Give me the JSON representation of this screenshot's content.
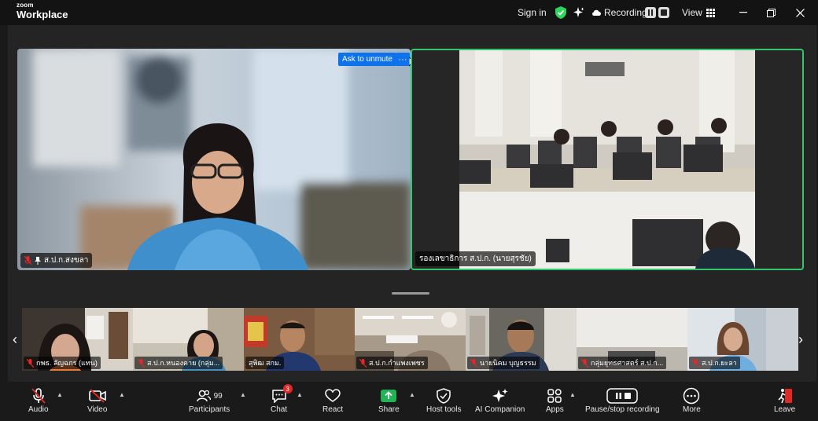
{
  "titlebar": {
    "brand_small": "zoom",
    "brand_big": "Workplace",
    "sign_in": "Sign in",
    "recording": "Recording...",
    "view": "View"
  },
  "stage": {
    "ask_to_unmute": "Ask to unmute",
    "more": "···",
    "speaker_left": "ส.ป.ก.สงขลา",
    "speaker_right": "รองเลขาธิการ ส.ป.ก. (นายสุรชัย)"
  },
  "strip": [
    {
      "name": "กพธ. ลัญฉกร (แทน)",
      "bg": "#3d3530"
    },
    {
      "name": "ส.ป.ก.หนองคาย (กลุ่ม...",
      "bg": "#c8c2b5"
    },
    {
      "name": "สุพิฒ สกม.",
      "bg": "#7a5a40"
    },
    {
      "name": "ส.ป.ก.กำแพงเพชร",
      "bg": "#a89a88"
    },
    {
      "name": "นายนิคม บุญธรรม",
      "bg": "#6a6660"
    },
    {
      "name": "กลุ่มยุทธศาสตร์ ส.ป.ก...",
      "bg": "#d8d6d2"
    },
    {
      "name": "ส.ป.ก.ยะลา",
      "bg": "#b8c3cc"
    }
  ],
  "toolbar": {
    "audio": "Audio",
    "video": "Video",
    "participants": "Participants",
    "participants_count": "99",
    "chat": "Chat",
    "chat_badge": "3",
    "react": "React",
    "share": "Share",
    "host_tools": "Host tools",
    "ai_companion": "AI Companion",
    "apps": "Apps",
    "pause_stop": "Pause/stop recording",
    "more": "More",
    "leave": "Leave"
  },
  "colors": {
    "accent_blue": "#0e72ed",
    "share_green": "#22b357",
    "active_border": "#35c470",
    "leave_red": "#e02828",
    "shield_green": "#2bd65a"
  }
}
